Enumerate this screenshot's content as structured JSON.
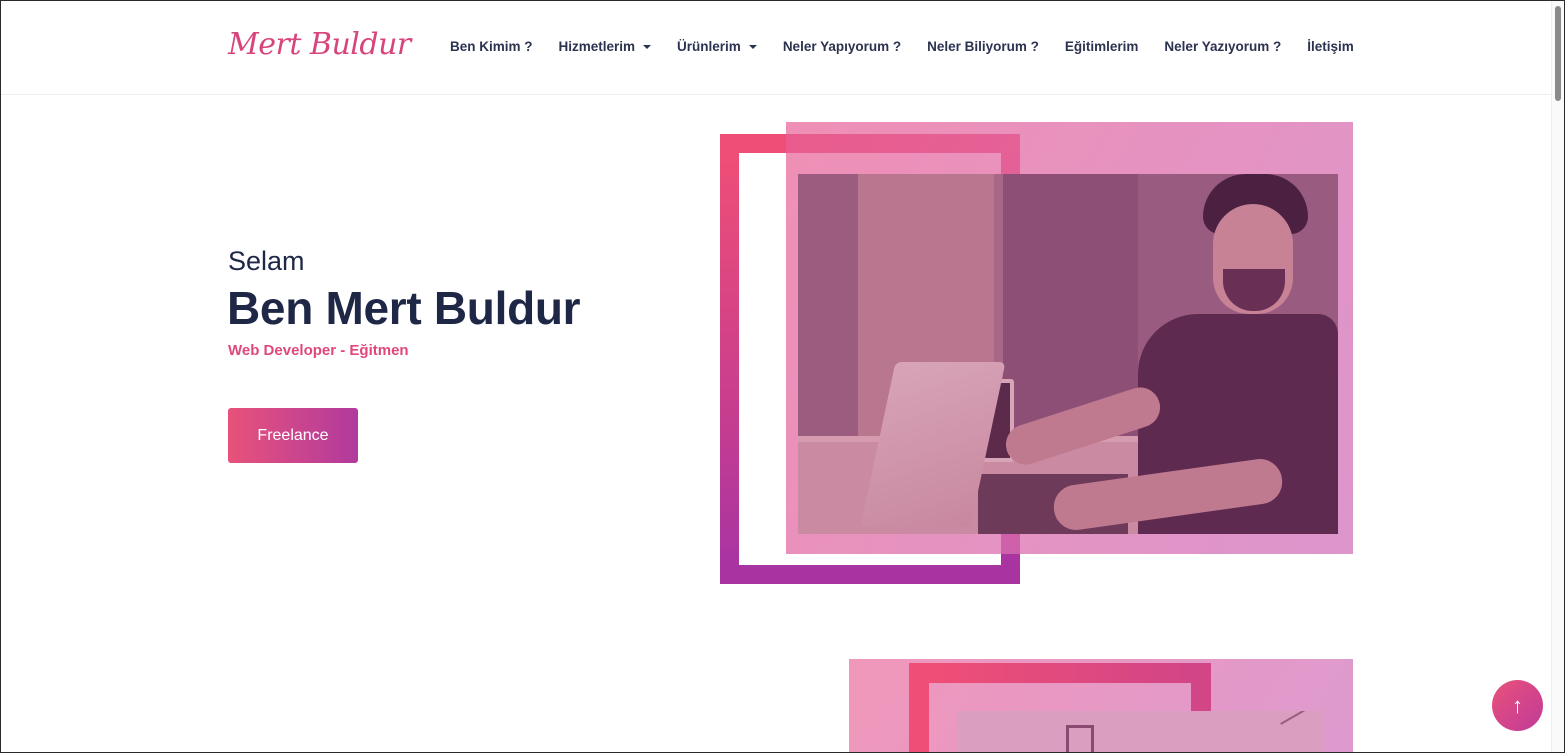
{
  "header": {
    "logo": "Mert Buldur",
    "nav": [
      {
        "label": "Ben Kimim ?",
        "dropdown": false
      },
      {
        "label": "Hizmetlerim",
        "dropdown": true
      },
      {
        "label": "Ürünlerim",
        "dropdown": true
      },
      {
        "label": "Neler Yapıyorum ?",
        "dropdown": false
      },
      {
        "label": "Neler Biliyorum ?",
        "dropdown": false
      },
      {
        "label": "Eğitimlerim",
        "dropdown": false
      },
      {
        "label": "Neler Yazıyorum ?",
        "dropdown": false
      },
      {
        "label": "İletişim",
        "dropdown": false
      }
    ]
  },
  "hero": {
    "greeting": "Selam",
    "name": "Ben Mert Buldur",
    "role": "Web Developer - Eğitmen",
    "cta_label": "Freelance"
  },
  "to_top": {
    "icon": "arrow-up-icon",
    "glyph": "↑"
  },
  "colors": {
    "accent": "#e0487a",
    "accent_purple": "#b13a9e",
    "text_dark": "#1e2746"
  }
}
